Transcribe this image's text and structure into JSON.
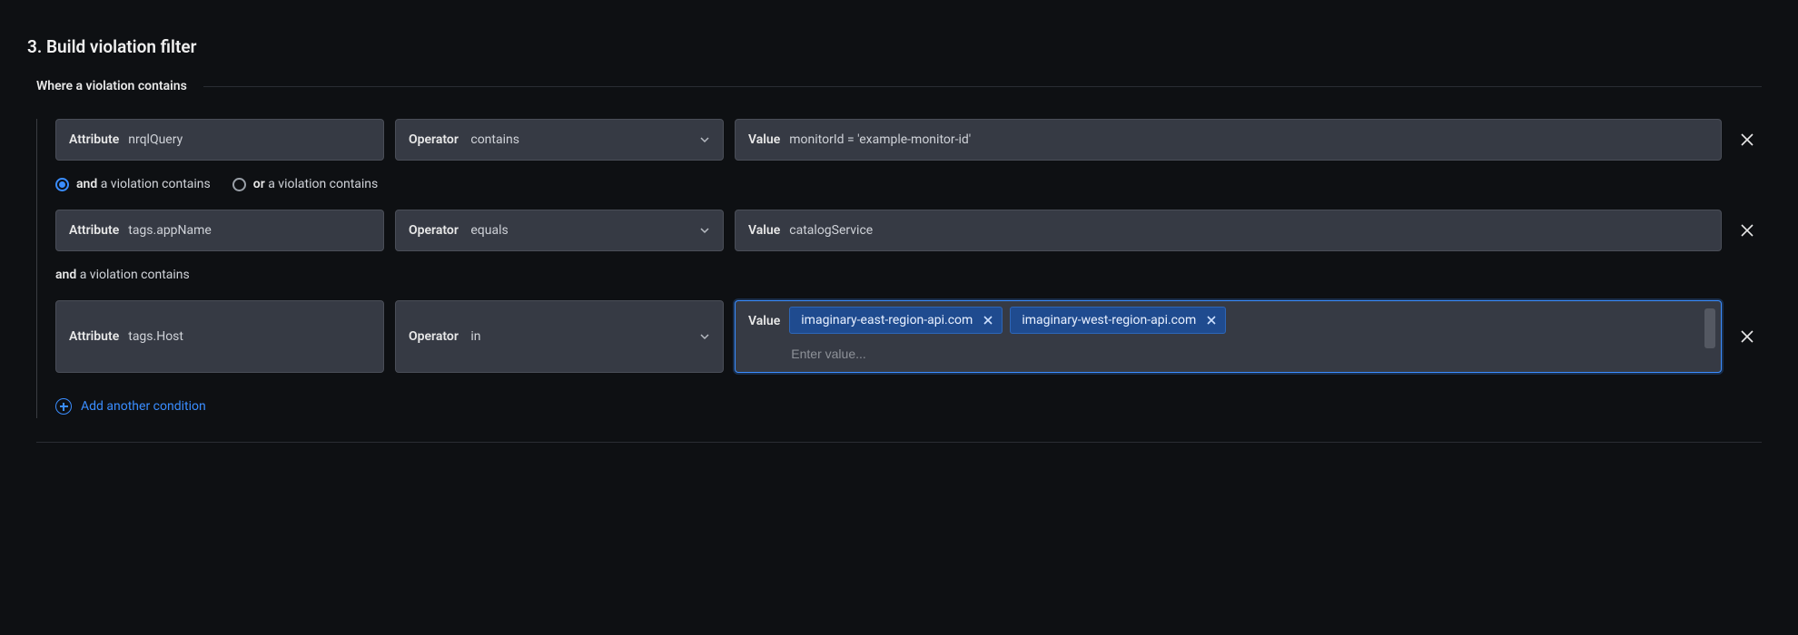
{
  "section": {
    "title": "3. Build violation filter",
    "legend": "Where a violation contains"
  },
  "labels": {
    "attribute": "Attribute",
    "operator": "Operator",
    "value": "Value"
  },
  "conditions": [
    {
      "attribute": "nrqlQuery",
      "operator": "contains",
      "value_text": "monitorId = 'example-monitor-id'"
    },
    {
      "attribute": "tags.appName",
      "operator": "equals",
      "value_text": "catalogService"
    },
    {
      "attribute": "tags.Host",
      "operator": "in",
      "value_tags": [
        "imaginary-east-region-api.com",
        "imaginary-west-region-api.com"
      ],
      "value_placeholder": "Enter value..."
    }
  ],
  "logic": {
    "and_strong": "and",
    "and_rest": " a violation contains",
    "or_strong": "or",
    "or_rest": " a violation contains",
    "selected": "and"
  },
  "logic_static": {
    "strong": "and",
    "rest": " a violation contains"
  },
  "add_another": "Add another condition"
}
